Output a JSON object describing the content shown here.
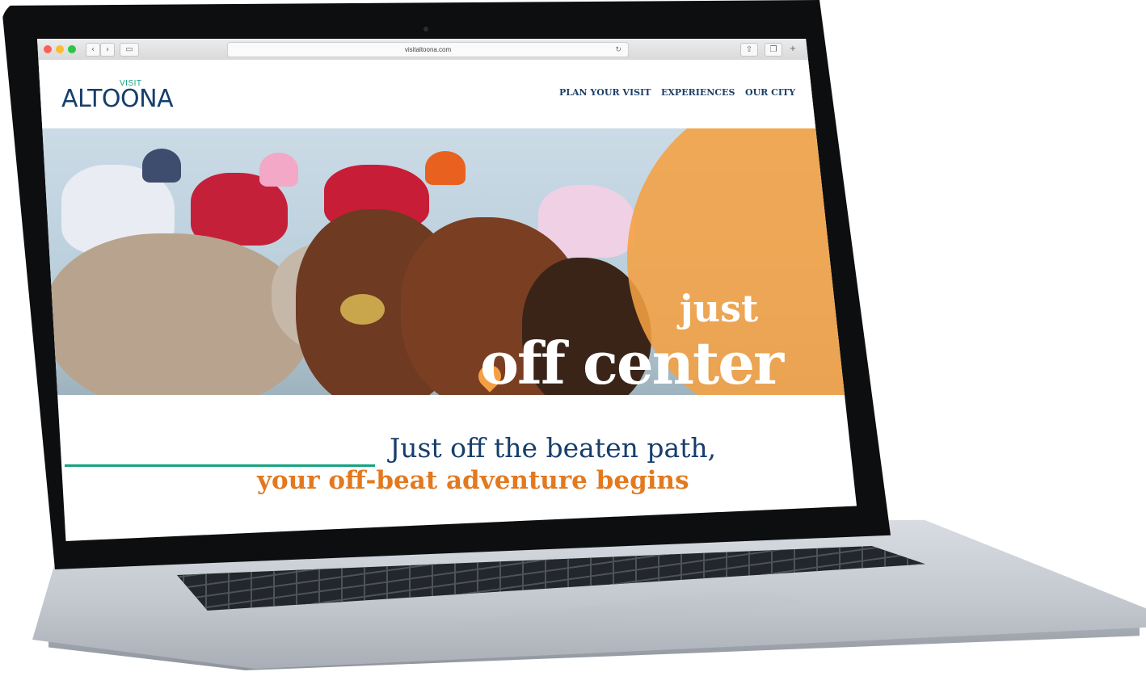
{
  "browser": {
    "url": "visitaltoona.com",
    "back_icon": "chevron-left-icon",
    "forward_icon": "chevron-right-icon",
    "sidebar_icon": "sidebar-icon",
    "reload_icon": "reload-icon",
    "share_icon": "share-icon",
    "tabs_icon": "tabs-icon",
    "new_tab_icon": "plus-icon"
  },
  "site": {
    "logo_small": "VISIT",
    "logo_main": "ALTOONA",
    "nav": [
      "PLAN YOUR VISIT",
      "EXPERIENCES",
      "OUR CITY"
    ]
  },
  "hero": {
    "tagline_top": "just",
    "tagline_bottom": "off center",
    "pin_icon": "map-pin-icon"
  },
  "intro": {
    "line1": "Just off the beaten path,",
    "line2": "your off-beat adventure begins"
  },
  "colors": {
    "navy": "#163e6b",
    "green": "#16a37f",
    "orange": "#e3791f",
    "circle_orange": "#f4a042"
  }
}
